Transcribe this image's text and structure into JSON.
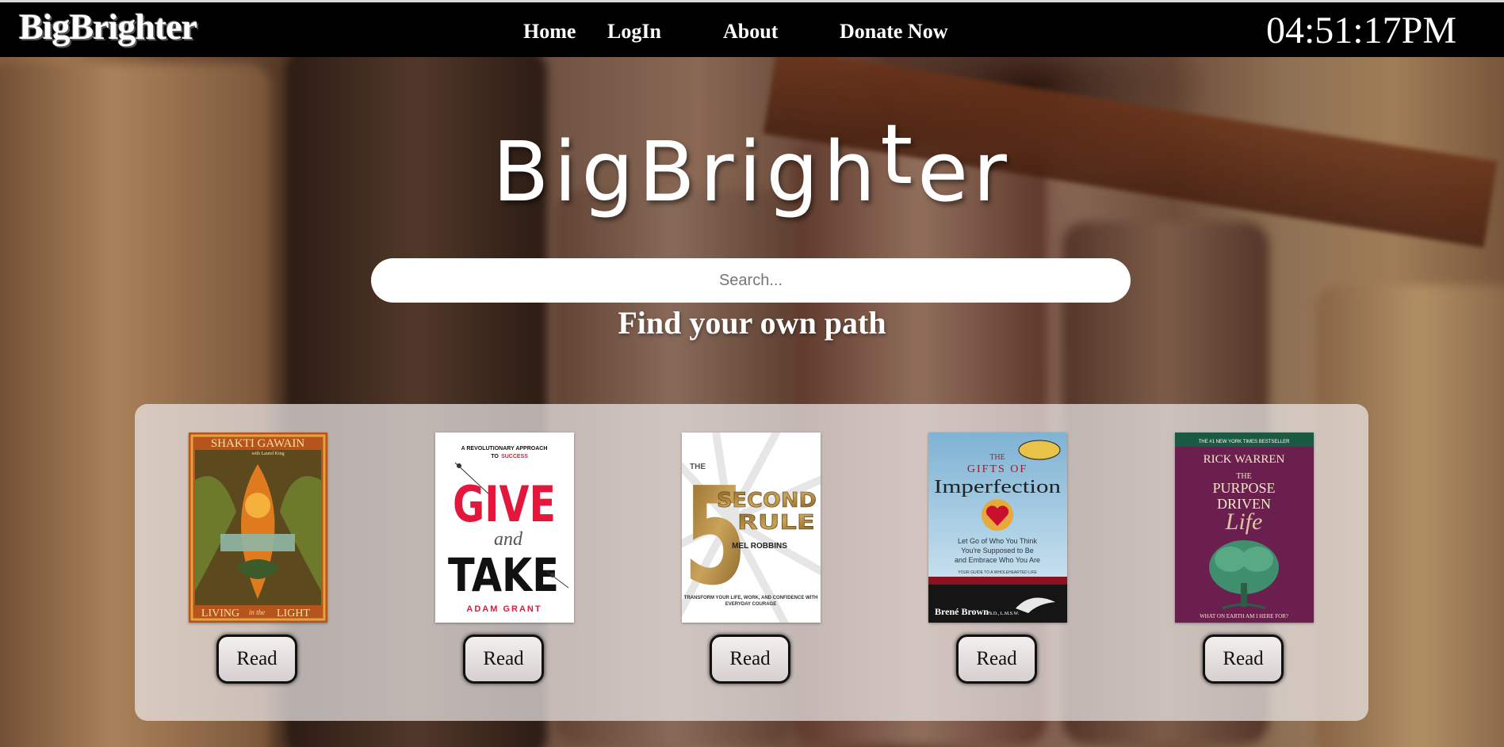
{
  "header": {
    "brand": "BigBrighter",
    "nav": [
      "Home",
      "LogIn",
      "About",
      "Donate Now"
    ],
    "clock": "04:51:17PM"
  },
  "hero": {
    "title_a": "BigBrigh",
    "title_t": "t",
    "title_b": "er",
    "search_placeholder": "Search...",
    "tagline": "Find your own path"
  },
  "books": [
    {
      "read_label": "Read",
      "cover": {
        "author": "SHAKTI GAWAIN",
        "title_a": "LIVING",
        "title_b": "in the",
        "title_c": "LIGHT",
        "coauthor": "with Laurel King"
      }
    },
    {
      "read_label": "Read",
      "cover": {
        "tag_a": "A REVOLUTIONARY APPROACH",
        "tag_b": "TO",
        "tag_c": "SUCCESS",
        "title_a": "GIVE",
        "title_and": "and",
        "title_b": "TAKE",
        "author": "ADAM GRANT"
      }
    },
    {
      "read_label": "Read",
      "cover": {
        "the": "THE",
        "five": "5",
        "second": "SECOND",
        "rule": "RULE",
        "author": "MEL ROBBINS",
        "sub_a": "TRANSFORM YOUR LIFE, WORK, AND CONFIDENCE WITH",
        "sub_b": "EVERYDAY COURAGE"
      }
    },
    {
      "read_label": "Read",
      "cover": {
        "the": "THE",
        "gifts": "GIFTS OF",
        "title": "Imperfection",
        "sub_a": "Let Go of Who You Think",
        "sub_b": "You're Supposed to Be",
        "sub_c": "and Embrace Who You Are",
        "guide": "YOUR GUIDE TO A WHOLEHEARTED LIFE",
        "author": "Brené Brown",
        "cred": "Ph.D., L.M.S.W."
      }
    },
    {
      "read_label": "Read",
      "cover": {
        "banner": "THE #1 NEW YORK TIMES BESTSELLER",
        "author": "RICK WARREN",
        "the": "THE",
        "purpose": "PURPOSE",
        "driven": "DRIVEN",
        "life": "Life",
        "question": "WHAT ON EARTH AM I HERE FOR?"
      }
    }
  ],
  "colors": {
    "nav_bg": "#000000",
    "panel_bg": "#ece8e8",
    "give_red": "#e3173b",
    "five_gold": "#b08a3c",
    "pdl_purple": "#6b1f4f",
    "heart_red": "#c8102e"
  }
}
